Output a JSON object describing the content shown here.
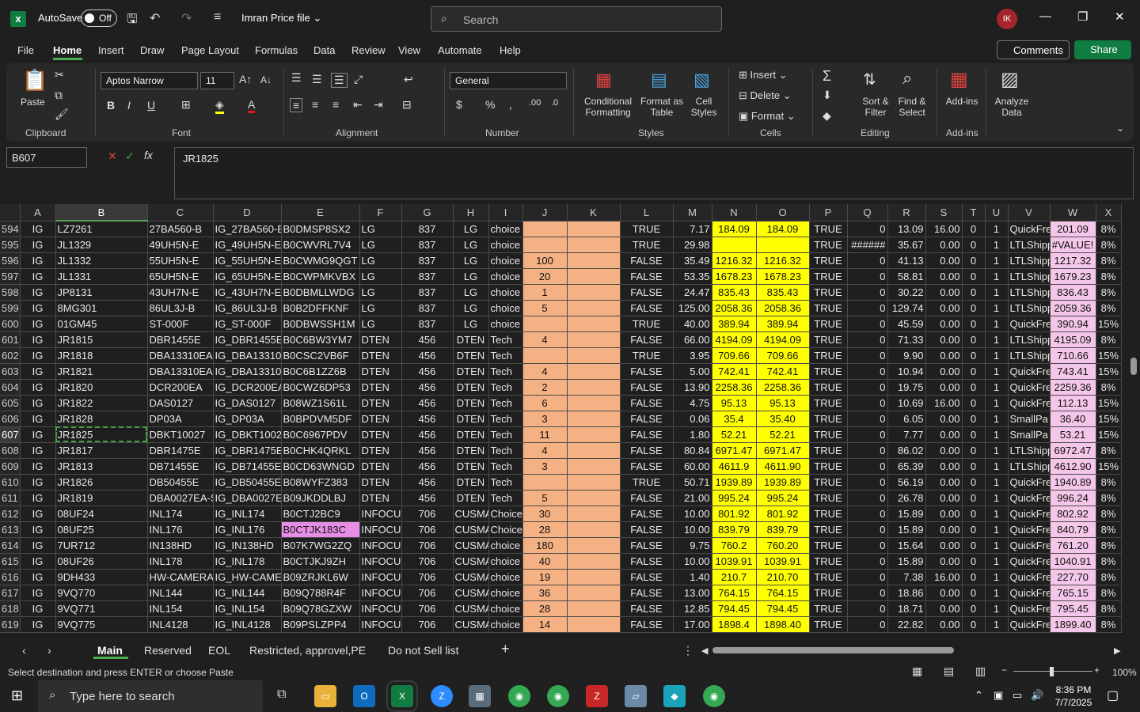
{
  "titlebar": {
    "autosave_label": "AutoSave",
    "autosave_state": "Off",
    "file_name": "Imran Price file",
    "search_placeholder": "Search",
    "user_initials": "IK"
  },
  "menu": [
    "File",
    "Home",
    "Insert",
    "Draw",
    "Page Layout",
    "Formulas",
    "Data",
    "Review",
    "View",
    "Automate",
    "Help"
  ],
  "actions": {
    "comments": "Comments",
    "share": "Share"
  },
  "ribbon": {
    "paste": "Paste",
    "font_name": "Aptos Narrow",
    "font_size": "11",
    "number_format": "General",
    "conditional_formatting": [
      "Conditional",
      "Formatting"
    ],
    "format_as_table": [
      "Format as",
      "Table"
    ],
    "cell_styles": [
      "Cell",
      "Styles"
    ],
    "insert": "Insert",
    "delete": "Delete",
    "format": "Format",
    "sort_filter": [
      "Sort &",
      "Filter"
    ],
    "find_select": [
      "Find &",
      "Select"
    ],
    "addins": "Add-ins",
    "analyze": [
      "Analyze",
      "Data"
    ],
    "groups": [
      "Clipboard",
      "Font",
      "Alignment",
      "Number",
      "Styles",
      "Cells",
      "Editing",
      "Add-ins"
    ]
  },
  "formula": {
    "name_box": "B607",
    "content": "JR1825"
  },
  "columns": [
    "A",
    "B",
    "C",
    "D",
    "E",
    "F",
    "G",
    "H",
    "I",
    "J",
    "K",
    "L",
    "M",
    "N",
    "O",
    "P",
    "Q",
    "R",
    "S",
    "T",
    "U",
    "V",
    "W",
    "X"
  ],
  "rows": [
    [
      "594",
      "IG",
      "LZ7261",
      "27BA560-B",
      "IG_27BA560-B",
      "B0DMSP8SX2",
      "LG",
      "837",
      "LG",
      "choice",
      "",
      "",
      "TRUE",
      "7.17",
      "184.09",
      "184.09",
      "TRUE",
      "0",
      "13.09",
      "16.00",
      "0",
      "1",
      "QuickFre",
      "201.09",
      "8%"
    ],
    [
      "595",
      "IG",
      "JL1329",
      "49UH5N-E",
      "IG_49UH5N-E",
      "B0CWVRL7V4",
      "LG",
      "837",
      "LG",
      "choice",
      "",
      "",
      "TRUE",
      "29.98",
      "",
      "",
      "TRUE",
      "######",
      "35.67",
      "0.00",
      "0",
      "1",
      "LTLShipp",
      "#VALUE!",
      "8%"
    ],
    [
      "596",
      "IG",
      "JL1332",
      "55UH5N-E",
      "IG_55UH5N-E",
      "B0CWMG9QGT",
      "LG",
      "837",
      "LG",
      "choice",
      "100",
      "",
      "FALSE",
      "35.49",
      "1216.32",
      "1216.32",
      "TRUE",
      "0",
      "41.13",
      "0.00",
      "0",
      "1",
      "LTLShipp",
      "1217.32",
      "8%"
    ],
    [
      "597",
      "IG",
      "JL1331",
      "65UH5N-E",
      "IG_65UH5N-E",
      "B0CWPMKVBX",
      "LG",
      "837",
      "LG",
      "choice",
      "20",
      "",
      "FALSE",
      "53.35",
      "1678.23",
      "1678.23",
      "TRUE",
      "0",
      "58.81",
      "0.00",
      "0",
      "1",
      "LTLShipp",
      "1679.23",
      "8%"
    ],
    [
      "598",
      "IG",
      "JP8131",
      "43UH7N-E",
      "IG_43UH7N-E",
      "B0DBMLLWDG",
      "LG",
      "837",
      "LG",
      "choice",
      "1",
      "",
      "FALSE",
      "24.47",
      "835.43",
      "835.43",
      "TRUE",
      "0",
      "30.22",
      "0.00",
      "0",
      "1",
      "LTLShipp",
      "836.43",
      "8%"
    ],
    [
      "599",
      "IG",
      "8MG301",
      "86UL3J-B",
      "IG_86UL3J-B",
      "B0B2DFFKNF",
      "LG",
      "837",
      "LG",
      "choice",
      "5",
      "",
      "FALSE",
      "125.00",
      "2058.36",
      "2058.36",
      "TRUE",
      "0",
      "129.74",
      "0.00",
      "0",
      "1",
      "LTLShipp",
      "2059.36",
      "8%"
    ],
    [
      "600",
      "IG",
      "01GM45",
      "ST-000F",
      "IG_ST-000F",
      "B0DBWSSH1M",
      "LG",
      "837",
      "LG",
      "choice",
      "",
      "",
      "TRUE",
      "40.00",
      "389.94",
      "389.94",
      "TRUE",
      "0",
      "45.59",
      "0.00",
      "0",
      "1",
      "QuickFre",
      "390.94",
      "15%"
    ],
    [
      "601",
      "IG",
      "JR1815",
      "DBR1455E",
      "IG_DBR1455E",
      "B0C6BW3YM7",
      "DTEN",
      "456",
      "DTEN",
      "Tech",
      "4",
      "",
      "FALSE",
      "66.00",
      "4194.09",
      "4194.09",
      "TRUE",
      "0",
      "71.33",
      "0.00",
      "0",
      "1",
      "LTLShipp",
      "4195.09",
      "8%"
    ],
    [
      "602",
      "IG",
      "JR1818",
      "DBA13310EA-",
      "IG_DBA13310E",
      "B0CSC2VB6F",
      "DTEN",
      "456",
      "DTEN",
      "Tech",
      "",
      "",
      "TRUE",
      "3.95",
      "709.66",
      "709.66",
      "TRUE",
      "0",
      "9.90",
      "0.00",
      "0",
      "1",
      "LTLShipp",
      "710.66",
      "15%"
    ],
    [
      "603",
      "IG",
      "JR1821",
      "DBA13310EA-",
      "IG_DBA13310E",
      "B0C6B1ZZ6B",
      "DTEN",
      "456",
      "DTEN",
      "Tech",
      "4",
      "",
      "FALSE",
      "5.00",
      "742.41",
      "742.41",
      "TRUE",
      "0",
      "10.94",
      "0.00",
      "0",
      "1",
      "QuickFre",
      "743.41",
      "15%"
    ],
    [
      "604",
      "IG",
      "JR1820",
      "DCR200EA",
      "IG_DCR200EA",
      "B0CWZ6DP53",
      "DTEN",
      "456",
      "DTEN",
      "Tech",
      "2",
      "",
      "FALSE",
      "13.90",
      "2258.36",
      "2258.36",
      "TRUE",
      "0",
      "19.75",
      "0.00",
      "0",
      "1",
      "QuickFre",
      "2259.36",
      "8%"
    ],
    [
      "605",
      "IG",
      "JR1822",
      "DAS0127",
      "IG_DAS0127",
      "B08WZ1S61L",
      "DTEN",
      "456",
      "DTEN",
      "Tech",
      "6",
      "",
      "FALSE",
      "4.75",
      "95.13",
      "95.13",
      "TRUE",
      "0",
      "10.69",
      "16.00",
      "0",
      "1",
      "QuickFre",
      "112.13",
      "15%"
    ],
    [
      "606",
      "IG",
      "JR1828",
      "DP03A",
      "IG_DP03A",
      "B0BPDVM5DF",
      "DTEN",
      "456",
      "DTEN",
      "Tech",
      "3",
      "",
      "FALSE",
      "0.06",
      "35.4",
      "35.40",
      "TRUE",
      "0",
      "6.05",
      "0.00",
      "0",
      "1",
      "SmallPa",
      "36.40",
      "15%"
    ],
    [
      "607",
      "IG",
      "JR1825",
      "DBKT10027",
      "IG_DBKT10027",
      "B0C6967PDV",
      "DTEN",
      "456",
      "DTEN",
      "Tech",
      "11",
      "",
      "FALSE",
      "1.80",
      "52.21",
      "52.21",
      "TRUE",
      "0",
      "7.77",
      "0.00",
      "0",
      "1",
      "SmallPa",
      "53.21",
      "15%"
    ],
    [
      "608",
      "IG",
      "JR1817",
      "DBR1475E",
      "IG_DBR1475E",
      "B0CHK4QRKL",
      "DTEN",
      "456",
      "DTEN",
      "Tech",
      "4",
      "",
      "FALSE",
      "80.84",
      "6971.47",
      "6971.47",
      "TRUE",
      "0",
      "86.02",
      "0.00",
      "0",
      "1",
      "LTLShipp",
      "6972.47",
      "8%"
    ],
    [
      "609",
      "IG",
      "JR1813",
      "DB71455E",
      "IG_DB71455E",
      "B0CD63WNGD",
      "DTEN",
      "456",
      "DTEN",
      "Tech",
      "3",
      "",
      "FALSE",
      "60.00",
      "4611.9",
      "4611.90",
      "TRUE",
      "0",
      "65.39",
      "0.00",
      "0",
      "1",
      "LTLShipp",
      "4612.90",
      "15%"
    ],
    [
      "610",
      "IG",
      "JR1826",
      "DB50455E",
      "IG_DB50455E",
      "B08WYFZ383",
      "DTEN",
      "456",
      "DTEN",
      "Tech",
      "",
      "",
      "TRUE",
      "50.71",
      "1939.89",
      "1939.89",
      "TRUE",
      "0",
      "56.19",
      "0.00",
      "0",
      "1",
      "QuickFre",
      "1940.89",
      "8%"
    ],
    [
      "611",
      "IG",
      "JR1819",
      "DBA0027EA-S",
      "IG_DBA0027EA",
      "B09JKDDLBJ",
      "DTEN",
      "456",
      "DTEN",
      "Tech",
      "5",
      "",
      "FALSE",
      "21.00",
      "995.24",
      "995.24",
      "TRUE",
      "0",
      "26.78",
      "0.00",
      "0",
      "1",
      "QuickFre",
      "996.24",
      "8%"
    ],
    [
      "612",
      "IG",
      "08UF24",
      "INL174",
      "IG_INL174",
      "B0CTJ2BC9",
      "INFOCU",
      "706",
      "CUSMAN",
      "Choice",
      "30",
      "",
      "FALSE",
      "10.00",
      "801.92",
      "801.92",
      "TRUE",
      "0",
      "15.89",
      "0.00",
      "0",
      "1",
      "QuickFre",
      "802.92",
      "8%"
    ],
    [
      "613",
      "IG",
      "08UF25",
      "INL176",
      "IG_INL176",
      "B0CTJK183C",
      "INFOCU",
      "706",
      "CUSMAN",
      "Choice",
      "28",
      "",
      "FALSE",
      "10.00",
      "839.79",
      "839.79",
      "TRUE",
      "0",
      "15.89",
      "0.00",
      "0",
      "1",
      "QuickFre",
      "840.79",
      "8%"
    ],
    [
      "614",
      "IG",
      "7UR712",
      "IN138HD",
      "IG_IN138HD",
      "B07K7WG2ZQ",
      "INFOCU",
      "706",
      "CUSMAN",
      "choice",
      "180",
      "",
      "FALSE",
      "9.75",
      "760.2",
      "760.20",
      "TRUE",
      "0",
      "15.64",
      "0.00",
      "0",
      "1",
      "QuickFre",
      "761.20",
      "8%"
    ],
    [
      "615",
      "IG",
      "08UF26",
      "INL178",
      "IG_INL178",
      "B0CTJKJ9ZH",
      "INFOCU",
      "706",
      "CUSMAN",
      "choice",
      "40",
      "",
      "FALSE",
      "10.00",
      "1039.91",
      "1039.91",
      "TRUE",
      "0",
      "15.89",
      "0.00",
      "0",
      "1",
      "QuickFre",
      "1040.91",
      "8%"
    ],
    [
      "616",
      "IG",
      "9DH433",
      "HW-CAMERA-",
      "IG_HW-CAMER",
      "B09ZRJKL6W",
      "INFOCU",
      "706",
      "CUSMAN",
      "choice",
      "19",
      "",
      "FALSE",
      "1.40",
      "210.7",
      "210.70",
      "TRUE",
      "0",
      "7.38",
      "16.00",
      "0",
      "1",
      "QuickFre",
      "227.70",
      "8%"
    ],
    [
      "617",
      "IG",
      "9VQ770",
      "INL144",
      "IG_INL144",
      "B09Q788R4F",
      "INFOCU",
      "706",
      "CUSMAN",
      "choice",
      "36",
      "",
      "FALSE",
      "13.00",
      "764.15",
      "764.15",
      "TRUE",
      "0",
      "18.86",
      "0.00",
      "0",
      "1",
      "QuickFre",
      "765.15",
      "8%"
    ],
    [
      "618",
      "IG",
      "9VQ771",
      "INL154",
      "IG_INL154",
      "B09Q78GZXW",
      "INFOCU",
      "706",
      "CUSMAN",
      "choice",
      "28",
      "",
      "FALSE",
      "12.85",
      "794.45",
      "794.45",
      "TRUE",
      "0",
      "18.71",
      "0.00",
      "0",
      "1",
      "QuickFre",
      "795.45",
      "8%"
    ],
    [
      "619",
      "IG",
      "9VQ775",
      "INL4128",
      "IG_INL4128",
      "B09PSLZPP4",
      "INFOCU",
      "706",
      "CUSMAN",
      "choice",
      "14",
      "",
      "FALSE",
      "17.00",
      "1898.4",
      "1898.40",
      "TRUE",
      "0",
      "22.82",
      "0.00",
      "0",
      "1",
      "QuickFre",
      "1899.40",
      "8%"
    ]
  ],
  "sheet_tabs": [
    "Main",
    "Reserved",
    "EOL",
    "Restricted, approvel,PE",
    "Do not Sell list"
  ],
  "status": {
    "message": "Select destination and press ENTER or choose Paste",
    "zoom": "100%"
  },
  "taskbar": {
    "search_placeholder": "Type here to search",
    "time": "8:36 PM",
    "date": "7/7/2025"
  }
}
